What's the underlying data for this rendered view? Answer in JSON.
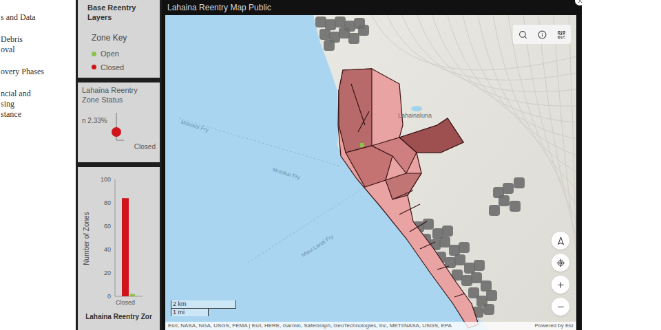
{
  "sidebar": {
    "groups": [
      {
        "lines": [
          "s and Data"
        ]
      },
      {
        "lines": [
          "Debris",
          "oval"
        ]
      },
      {
        "lines": [
          "overy Phases"
        ]
      },
      {
        "lines": [
          "ncial and",
          "sing",
          "stance"
        ]
      }
    ]
  },
  "layers_card": {
    "title": "Base Reentry Layers",
    "key_title": "Zone Key",
    "legend": [
      {
        "label": "Open",
        "color": "#8bc34a"
      },
      {
        "label": "Closed",
        "color": "#d0141c"
      }
    ]
  },
  "status_card": {
    "title": "Lahaina Reentry Zone Status",
    "reading": "n 2.33%",
    "label": "Closed"
  },
  "chart_card": {
    "axis_title": "Number of Zones",
    "ticks": [
      "100",
      "80",
      "60",
      "40",
      "20",
      "0"
    ],
    "series": [
      {
        "name": "Closed",
        "values": [
          84
        ],
        "color": "#d0141c"
      },
      {
        "name": "Open",
        "values": [
          2
        ],
        "color": "#8bc34a"
      }
    ],
    "x_labels": [
      "Closed"
    ],
    "title": "Lahaina Reentry Zor"
  },
  "map": {
    "title": "Lahaina Reentry Map Public",
    "place_labels": [
      "Lahainaluna"
    ],
    "ferry_labels": [
      "Molokai Fry",
      "Molokai Fry",
      "Maui Lanai Fry"
    ],
    "scale": [
      "2 km",
      "1 mi"
    ],
    "attribution": "Esri, NASA, NGA, USGS, FEMA | Esri, HERE, Garmin, SafeGraph, GeoTechnologies, Inc, METI/NASA, USGS, EPA",
    "powered_by": "Powered by Esr"
  }
}
